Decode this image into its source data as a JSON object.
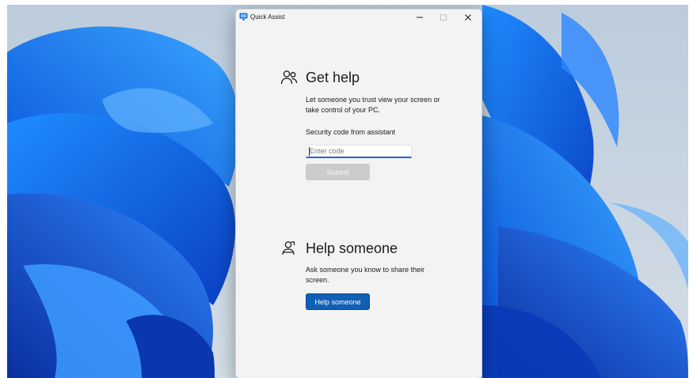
{
  "window": {
    "title": "Quick Assist",
    "app_icon": "quick-assist-icon",
    "controls": [
      "minimize-icon",
      "maximize-icon",
      "close-icon"
    ]
  },
  "get_help": {
    "icon": "people-icon",
    "heading": "Get help",
    "description": "Let someone you trust view your screen or take control of your PC.",
    "code_label": "Security code from assistant",
    "code_value": "",
    "code_placeholder": "Enter code",
    "submit_label": "Submit",
    "submit_enabled": false
  },
  "help_someone": {
    "icon": "person-assist-icon",
    "heading": "Help someone",
    "description": "Ask someone you know to share their screen.",
    "button_label": "Help someone"
  },
  "colors": {
    "accent": "#0f5fb5",
    "input_underline": "#2564c9",
    "disabled_button": "#cccccc",
    "window_background": "#f3f3f3"
  }
}
